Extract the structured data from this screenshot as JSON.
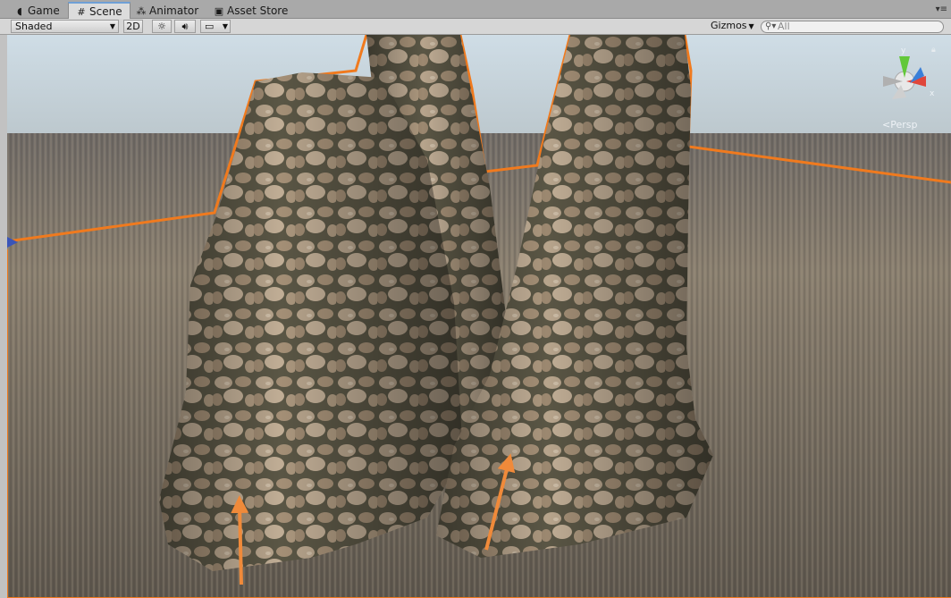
{
  "tabs": [
    {
      "label": "Game",
      "icon": "pacman-icon"
    },
    {
      "label": "Scene",
      "icon": "grid-icon"
    },
    {
      "label": "Animator",
      "icon": "animator-icon"
    },
    {
      "label": "Asset Store",
      "icon": "store-icon"
    }
  ],
  "toolbar": {
    "shading_mode": "Shaded",
    "mode_2d": "2D",
    "gizmos_label": "Gizmos",
    "search_placeholder": "All"
  },
  "viewport": {
    "projection_label": "Persp",
    "axis_labels": {
      "y": "y",
      "x": "x"
    },
    "colors": {
      "sky_top": "#c7d8e2",
      "horizon": "#7d7a78",
      "ground": "#6f665c",
      "selection_outline": "#f07a1e",
      "arrow": "#f08a3a",
      "rock_light": "#b5a089",
      "rock_dark": "#4d4a3c"
    }
  }
}
